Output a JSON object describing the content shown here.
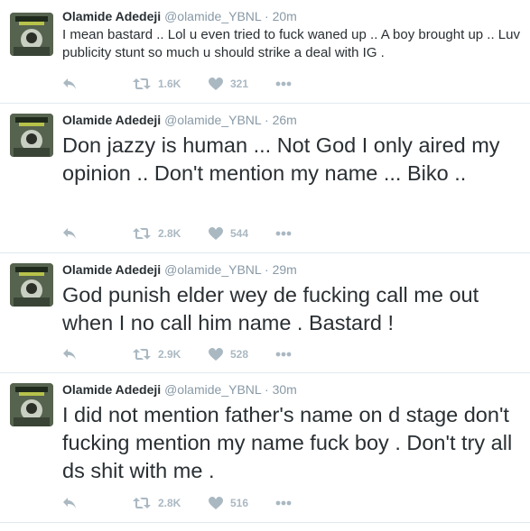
{
  "tweets": [
    {
      "name": "Olamide Adedeji",
      "handle": "@olamide_YBNL",
      "separator": "·",
      "time": "20m",
      "text": "I mean bastard .. Lol u even tried to fuck waned up .. A boy brought up .. Luv publicity stunt so much u should strike a deal with IG .",
      "retweets": "1.6K",
      "likes": "321"
    },
    {
      "name": "Olamide Adedeji",
      "handle": "@olamide_YBNL",
      "separator": "·",
      "time": "26m",
      "text": "Don jazzy is human ... Not God I only aired my opinion .. Don't mention my name ... Biko ..",
      "retweets": "2.8K",
      "likes": "544"
    },
    {
      "name": "Olamide Adedeji",
      "handle": "@olamide_YBNL",
      "separator": "·",
      "time": "29m",
      "text": "God punish elder wey de fucking call me out when I no call him name . Bastard !",
      "retweets": "2.9K",
      "likes": "528"
    },
    {
      "name": "Olamide Adedeji",
      "handle": "@olamide_YBNL",
      "separator": "·",
      "time": "30m",
      "text": "I did not mention father's name on d stage don't fucking mention my name fuck boy . Don't try all ds shit with me .",
      "retweets": "2.8K",
      "likes": "516"
    }
  ],
  "icons": {
    "reply": "reply-icon",
    "retweet": "retweet-icon",
    "like": "heart-icon",
    "more": "more-icon"
  },
  "colors": {
    "text": "#292f33",
    "muted": "#8899a6",
    "action": "#aab8c2",
    "divider": "#e1e8ed"
  }
}
